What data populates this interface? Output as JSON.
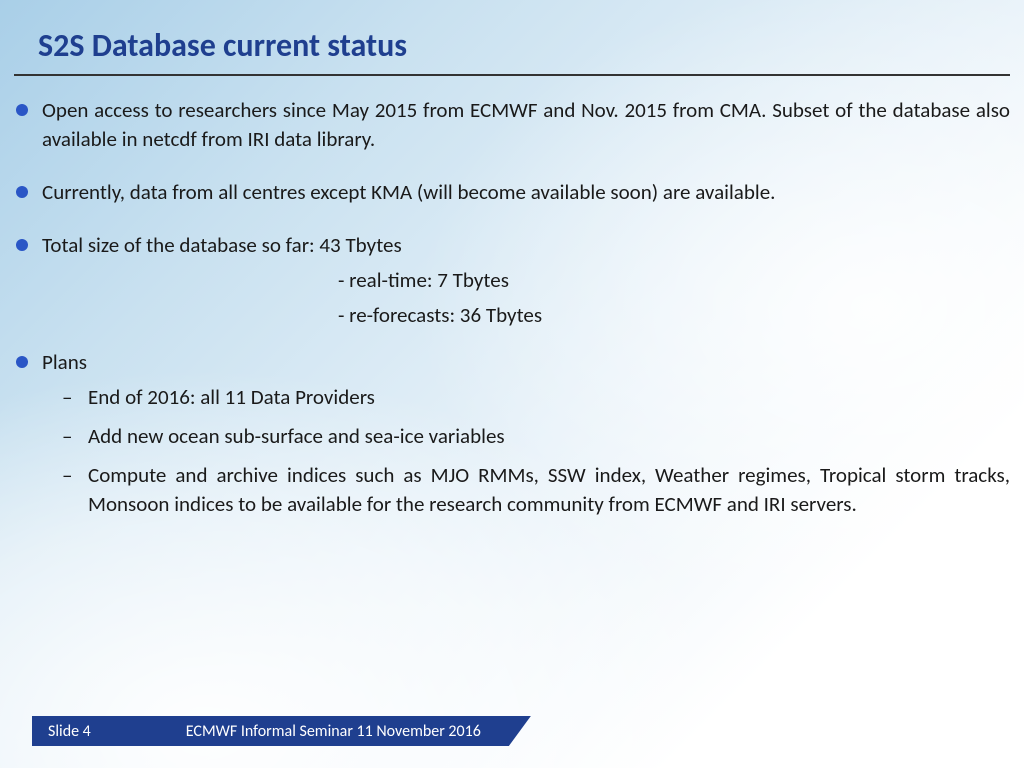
{
  "title": "S2S Database current status",
  "bullets": {
    "b1": "Open access to researchers since May 2015 from ECMWF and Nov. 2015 from CMA. Subset of the database also available in netcdf from IRI data library.",
    "b2": "Currently, data from all centres except KMA (will become available soon) are available.",
    "b3": "Total size of the database so far: 43 Tbytes",
    "b3_sub1": "- real-time: 7 Tbytes",
    "b3_sub2": "- re-forecasts: 36 Tbytes",
    "b4": "Plans",
    "b4_items": {
      "i1": "End of 2016: all 11 Data Providers",
      "i2": "Add new ocean sub-surface and sea-ice variables",
      "i3": "Compute and archive indices such as MJO RMMs, SSW index, Weather regimes, Tropical storm tracks, Monsoon indices to be available for the research community from ECMWF and IRI servers."
    }
  },
  "footer": {
    "slide_label": "Slide 4",
    "seminar": "ECMWF Informal Seminar 11 November 2016"
  }
}
